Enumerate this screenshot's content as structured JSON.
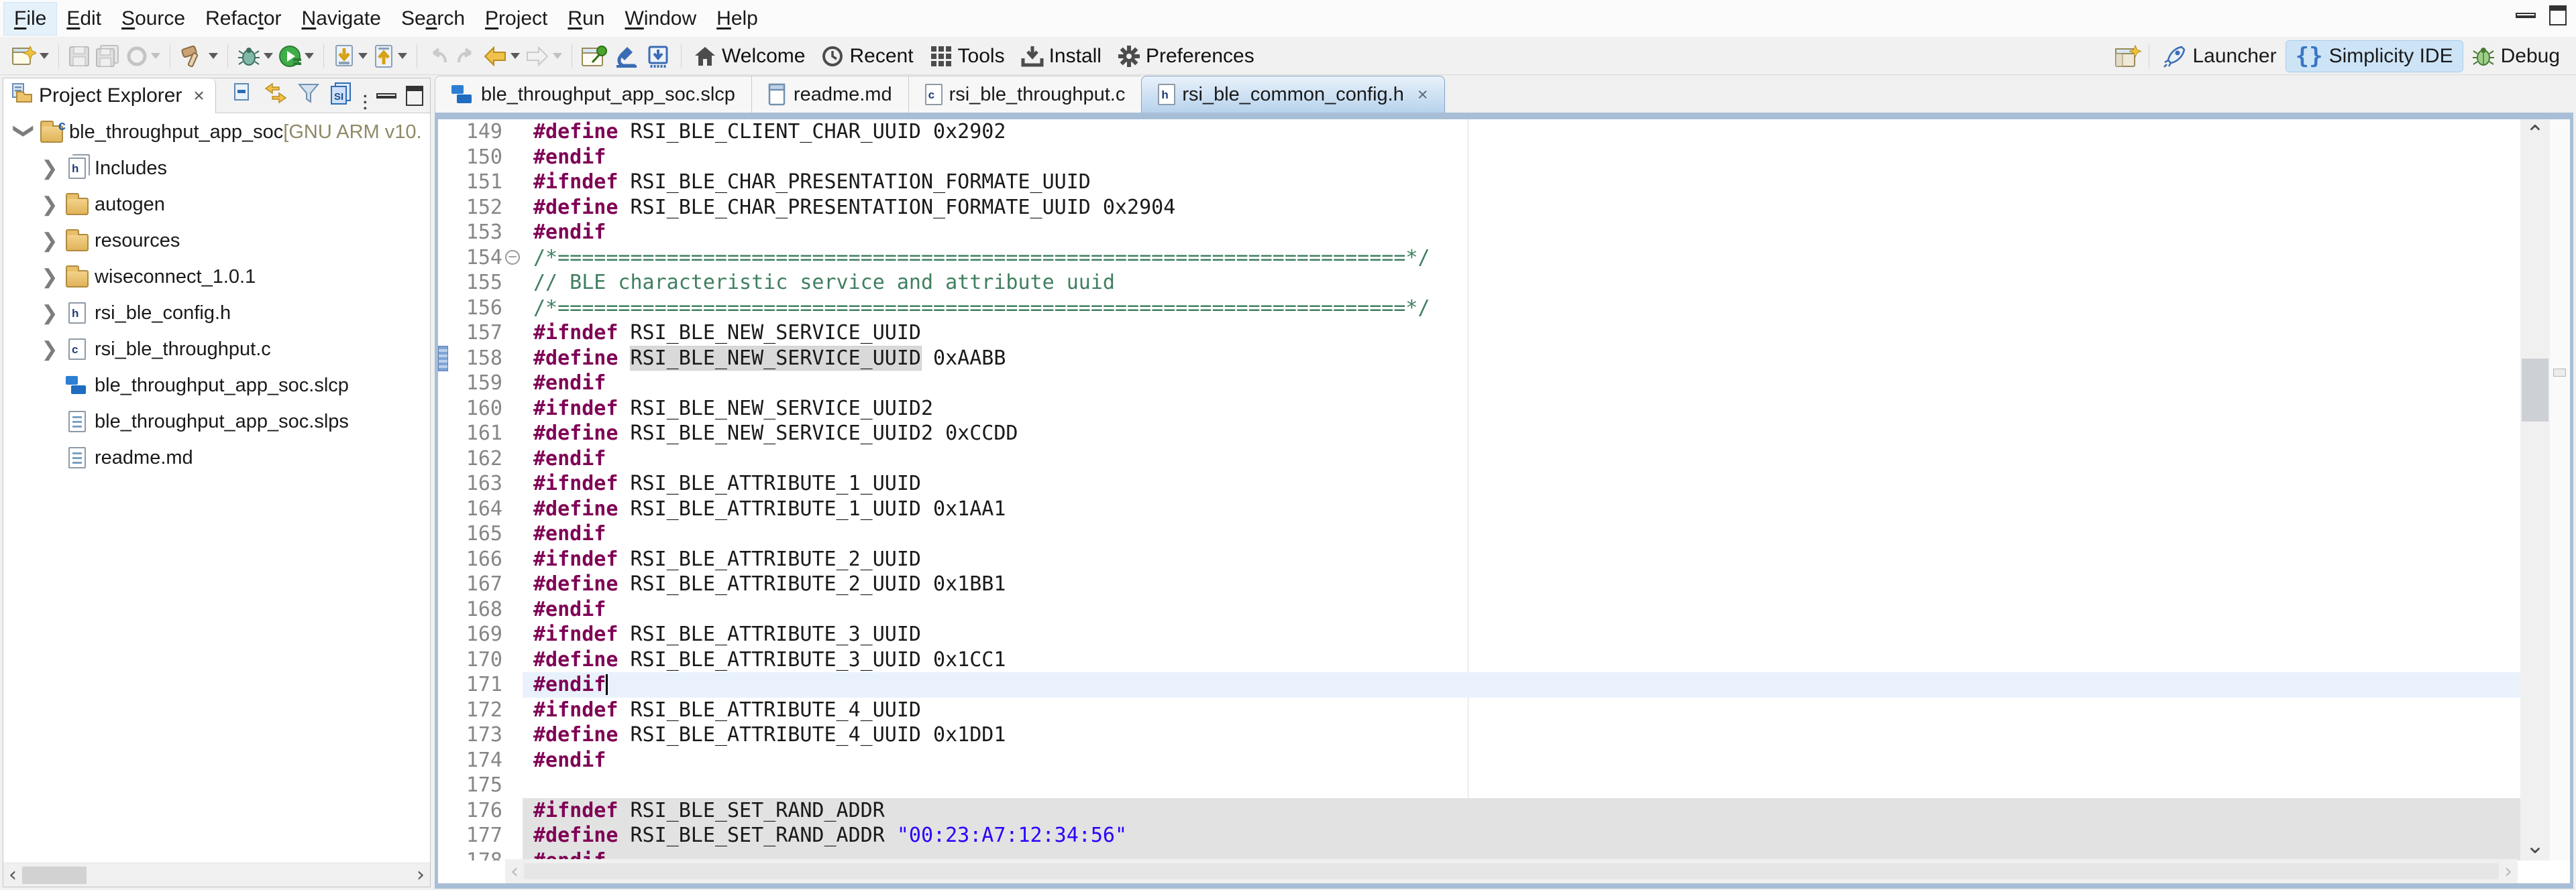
{
  "theme": {
    "frame_blue": "#a8bed6",
    "directive_color": "#7f0055",
    "comment_color": "#3f7f5f",
    "string_color": "#2a00ff",
    "current_line_bg": "#e9f2fc",
    "changed_block_bg": "#e2e2e2",
    "occurrence_bg": "#d9d9d9",
    "active_tab_bg": "#b7d2ec",
    "perspective_active_bg": "#cde4f7"
  },
  "menu_bar": {
    "items": [
      {
        "label": "File",
        "underline": 0
      },
      {
        "label": "Edit",
        "underline": 0
      },
      {
        "label": "Source",
        "underline": 0
      },
      {
        "label": "Refactor",
        "underline": 5
      },
      {
        "label": "Navigate",
        "underline": 0
      },
      {
        "label": "Search",
        "underline": 2
      },
      {
        "label": "Project",
        "underline": 0
      },
      {
        "label": "Run",
        "underline": 0
      },
      {
        "label": "Window",
        "underline": 0
      },
      {
        "label": "Help",
        "underline": 0
      }
    ]
  },
  "toolbar": {
    "groups": [
      {
        "buttons": [
          {
            "icon": "new-wizard-icon",
            "dropdown": true
          }
        ]
      },
      {
        "buttons": [
          {
            "icon": "save-icon",
            "disabled": true
          },
          {
            "icon": "save-all-icon",
            "disabled": true
          },
          {
            "icon": "history-icon",
            "dropdown": true,
            "disabled": true
          }
        ]
      },
      {
        "buttons": [
          {
            "icon": "build-hammer-icon",
            "dropdown": true
          }
        ]
      },
      {
        "buttons": [
          {
            "icon": "debug-bug-icon",
            "dropdown": true
          },
          {
            "icon": "run-icon",
            "dropdown": true
          }
        ]
      },
      {
        "buttons": [
          {
            "icon": "flash-download-icon",
            "dropdown": true
          },
          {
            "icon": "flash-upload-icon",
            "dropdown": true
          }
        ]
      },
      {
        "buttons": [
          {
            "icon": "back-curved-icon",
            "disabled": true
          },
          {
            "icon": "forward-curved-icon",
            "disabled": true
          },
          {
            "icon": "nav-back-icon",
            "dropdown": true
          },
          {
            "icon": "nav-forward-icon",
            "dropdown": true,
            "disabled": true
          }
        ]
      },
      {
        "buttons": [
          {
            "icon": "pin-view-icon"
          },
          {
            "icon": "microscope-icon"
          },
          {
            "icon": "chip-download-icon"
          }
        ]
      }
    ],
    "links": [
      {
        "icon": "home-icon",
        "label": "Welcome"
      },
      {
        "icon": "recent-clock-icon",
        "label": "Recent"
      },
      {
        "icon": "tools-grid-icon",
        "label": "Tools"
      },
      {
        "icon": "install-tray-icon",
        "label": "Install"
      },
      {
        "icon": "gear-icon",
        "label": "Preferences"
      }
    ]
  },
  "perspectives": {
    "open_icon": "open-perspective-icon",
    "items": [
      {
        "icon": "rocket-icon",
        "label": "Launcher",
        "active": false
      },
      {
        "icon": "braces-icon",
        "label": "Simplicity IDE",
        "active": true
      },
      {
        "icon": "bug-icon",
        "label": "Debug",
        "active": false
      }
    ]
  },
  "project_explorer": {
    "title": "Project Explorer",
    "close_label": "×",
    "tools": [
      "collapse-all-icon",
      "link-editor-icon",
      "filter-funnel-icon",
      "si-files-icon",
      "view-menu-icon"
    ],
    "tree": [
      {
        "indent": 0,
        "chevron": "expanded",
        "icon": "c-project-icon",
        "label": "ble_throughput_app_soc",
        "decoration": " [GNU ARM v10."
      },
      {
        "indent": 1,
        "chevron": "collapsed",
        "icon": "includes-icon",
        "label": "Includes"
      },
      {
        "indent": 1,
        "chevron": "collapsed",
        "icon": "folder-icon",
        "label": "autogen"
      },
      {
        "indent": 1,
        "chevron": "collapsed",
        "icon": "folder-icon",
        "label": "resources"
      },
      {
        "indent": 1,
        "chevron": "collapsed",
        "icon": "folder-icon",
        "label": "wiseconnect_1.0.1"
      },
      {
        "indent": 1,
        "chevron": "collapsed",
        "icon": "h-file-icon",
        "label": "rsi_ble_config.h"
      },
      {
        "indent": 1,
        "chevron": "collapsed",
        "icon": "c-file-icon",
        "label": "rsi_ble_throughput.c"
      },
      {
        "indent": 1,
        "chevron": "none",
        "icon": "slcp-icon",
        "label": "ble_throughput_app_soc.slcp"
      },
      {
        "indent": 1,
        "chevron": "none",
        "icon": "doc-icon",
        "label": "ble_throughput_app_soc.slps"
      },
      {
        "indent": 1,
        "chevron": "none",
        "icon": "doc-icon",
        "label": "readme.md"
      }
    ]
  },
  "editor": {
    "tabs": [
      {
        "icon": "slcp-icon",
        "label": "ble_throughput_app_soc.slcp",
        "active": false
      },
      {
        "icon": "md-doc-icon",
        "label": "readme.md",
        "active": false
      },
      {
        "icon": "c-file-icon",
        "label": "rsi_ble_throughput.c",
        "active": false
      },
      {
        "icon": "h-file-icon",
        "label": "rsi_ble_common_config.h",
        "active": true,
        "close_label": "×"
      }
    ],
    "lines": [
      {
        "n": 149,
        "t": [
          [
            "d",
            "#define"
          ],
          [
            "p",
            " RSI_BLE_CLIENT_CHAR_UUID 0x2902"
          ]
        ]
      },
      {
        "n": 150,
        "t": [
          [
            "d",
            "#endif"
          ]
        ]
      },
      {
        "n": 151,
        "t": [
          [
            "d",
            "#ifndef"
          ],
          [
            "p",
            " RSI_BLE_CHAR_PRESENTATION_FORMATE_UUID"
          ]
        ]
      },
      {
        "n": 152,
        "t": [
          [
            "d",
            "#define"
          ],
          [
            "p",
            " RSI_BLE_CHAR_PRESENTATION_FORMATE_UUID 0x2904"
          ]
        ]
      },
      {
        "n": 153,
        "t": [
          [
            "d",
            "#endif"
          ]
        ]
      },
      {
        "n": 154,
        "fold": true,
        "t": [
          [
            "c",
            "/*======================================================================*/"
          ]
        ]
      },
      {
        "n": 155,
        "t": [
          [
            "c",
            "// BLE characteristic service and attribute uuid"
          ]
        ]
      },
      {
        "n": 156,
        "t": [
          [
            "c",
            "/*======================================================================*/"
          ]
        ]
      },
      {
        "n": 157,
        "t": [
          [
            "d",
            "#ifndef"
          ],
          [
            "p",
            " RSI_BLE_NEW_SERVICE_UUID"
          ]
        ]
      },
      {
        "n": 158,
        "marker": true,
        "t": [
          [
            "d",
            "#define"
          ],
          [
            "p",
            " "
          ],
          [
            "o",
            "RSI_BLE_NEW_SERVICE_UUID"
          ],
          [
            "p",
            " 0xAABB"
          ]
        ]
      },
      {
        "n": 159,
        "t": [
          [
            "d",
            "#endif"
          ]
        ]
      },
      {
        "n": 160,
        "t": [
          [
            "d",
            "#ifndef"
          ],
          [
            "p",
            " RSI_BLE_NEW_SERVICE_UUID2"
          ]
        ]
      },
      {
        "n": 161,
        "t": [
          [
            "d",
            "#define"
          ],
          [
            "p",
            " RSI_BLE_NEW_SERVICE_UUID2 0xCCDD"
          ]
        ]
      },
      {
        "n": 162,
        "t": [
          [
            "d",
            "#endif"
          ]
        ]
      },
      {
        "n": 163,
        "t": [
          [
            "d",
            "#ifndef"
          ],
          [
            "p",
            " RSI_BLE_ATTRIBUTE_1_UUID"
          ]
        ]
      },
      {
        "n": 164,
        "t": [
          [
            "d",
            "#define"
          ],
          [
            "p",
            " RSI_BLE_ATTRIBUTE_1_UUID 0x1AA1"
          ]
        ]
      },
      {
        "n": 165,
        "t": [
          [
            "d",
            "#endif"
          ]
        ]
      },
      {
        "n": 166,
        "t": [
          [
            "d",
            "#ifndef"
          ],
          [
            "p",
            " RSI_BLE_ATTRIBUTE_2_UUID"
          ]
        ]
      },
      {
        "n": 167,
        "t": [
          [
            "d",
            "#define"
          ],
          [
            "p",
            " RSI_BLE_ATTRIBUTE_2_UUID 0x1BB1"
          ]
        ]
      },
      {
        "n": 168,
        "t": [
          [
            "d",
            "#endif"
          ]
        ]
      },
      {
        "n": 169,
        "t": [
          [
            "d",
            "#ifndef"
          ],
          [
            "p",
            " RSI_BLE_ATTRIBUTE_3_UUID"
          ]
        ]
      },
      {
        "n": 170,
        "t": [
          [
            "d",
            "#define"
          ],
          [
            "p",
            " RSI_BLE_ATTRIBUTE_3_UUID 0x1CC1"
          ]
        ]
      },
      {
        "n": 171,
        "cls": "current",
        "cursor": true,
        "t": [
          [
            "d",
            "#endif"
          ]
        ]
      },
      {
        "n": 172,
        "t": [
          [
            "d",
            "#ifndef"
          ],
          [
            "p",
            " RSI_BLE_ATTRIBUTE_4_UUID"
          ]
        ]
      },
      {
        "n": 173,
        "t": [
          [
            "d",
            "#define"
          ],
          [
            "p",
            " RSI_BLE_ATTRIBUTE_4_UUID 0x1DD1"
          ]
        ]
      },
      {
        "n": 174,
        "t": [
          [
            "d",
            "#endif"
          ]
        ]
      },
      {
        "n": 175,
        "t": []
      },
      {
        "n": 176,
        "cls": "changed",
        "t": [
          [
            "d",
            "#ifndef"
          ],
          [
            "p",
            " RSI_BLE_SET_RAND_ADDR"
          ]
        ]
      },
      {
        "n": 177,
        "cls": "changed",
        "t": [
          [
            "d",
            "#define"
          ],
          [
            "p",
            " RSI_BLE_SET_RAND_ADDR "
          ],
          [
            "s",
            "\"00:23:A7:12:34:56\""
          ]
        ]
      },
      {
        "n": 178,
        "cls": "changed",
        "t": [
          [
            "d",
            "#endif"
          ]
        ]
      }
    ]
  }
}
